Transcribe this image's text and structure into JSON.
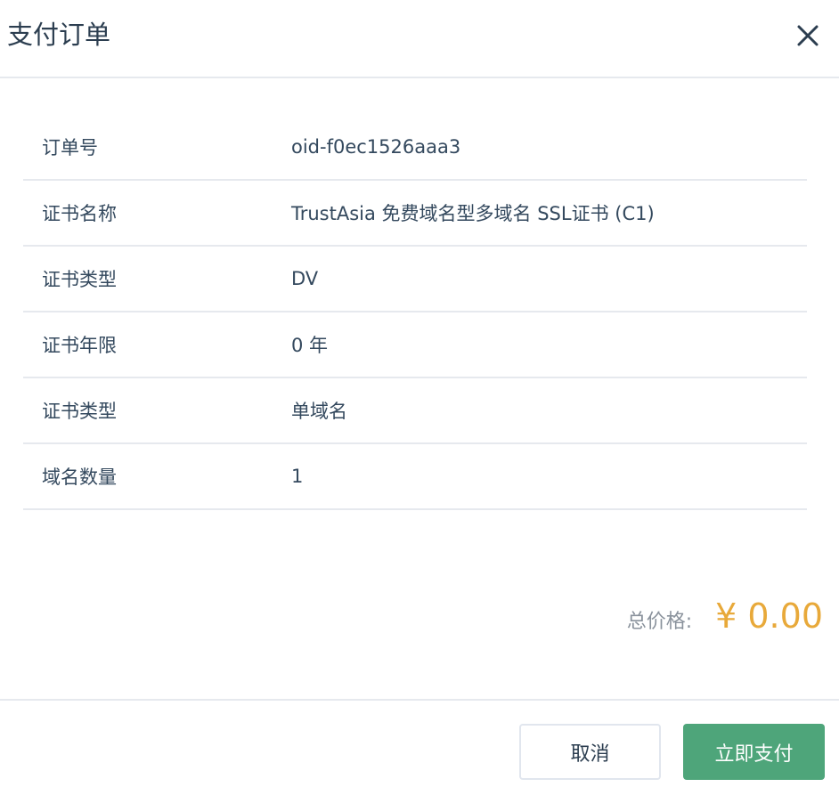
{
  "dialog": {
    "title": "支付订单"
  },
  "rows": [
    {
      "label": "订单号",
      "value": "oid-f0ec1526aaa3"
    },
    {
      "label": "证书名称",
      "value": "TrustAsia 免费域名型多域名 SSL证书 (C1)"
    },
    {
      "label": "证书类型",
      "value": "DV"
    },
    {
      "label": "证书年限",
      "value": "0 年"
    },
    {
      "label": "证书类型",
      "value": "单域名"
    },
    {
      "label": "域名数量",
      "value": "1"
    }
  ],
  "total": {
    "label": "总价格:",
    "value": "¥ 0.00"
  },
  "buttons": {
    "cancel": "取消",
    "pay": "立即支付"
  },
  "colors": {
    "accent": "#4ea57a",
    "price": "#e8a93a"
  }
}
